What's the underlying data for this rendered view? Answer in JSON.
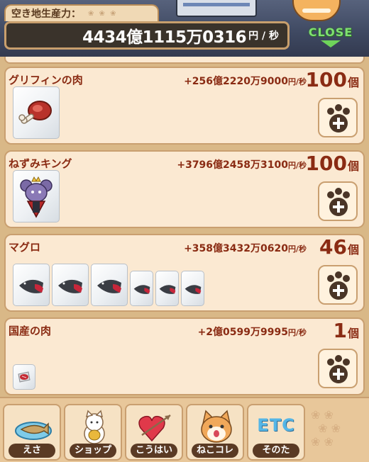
{
  "header": {
    "title": "空き地生産力：",
    "total_rate": "4434億1115万0316",
    "rate_unit": "円 / 秒",
    "close_label": "CLOSE"
  },
  "items": [
    {
      "name": "グリフィンの肉",
      "rate": "+256億2220万9000",
      "rate_unit": "円/秒",
      "count": "100",
      "count_unit": "個",
      "icon": "meat-leg-icon",
      "packs_shown": 1
    },
    {
      "name": "ねずみキング",
      "rate": "+3796億2458万3100",
      "rate_unit": "円/秒",
      "count": "100",
      "count_unit": "個",
      "icon": "rat-king-icon",
      "packs_shown": 1
    },
    {
      "name": "マグロ",
      "rate": "+358億3432万0620",
      "rate_unit": "円/秒",
      "count": "46",
      "count_unit": "個",
      "icon": "tuna-icon",
      "packs_shown": 6
    },
    {
      "name": "国産の肉",
      "rate": "+2億0599万9995",
      "rate_unit": "円/秒",
      "count": "1",
      "count_unit": "個",
      "icon": "steak-icon",
      "packs_shown": 1
    }
  ],
  "tabs": [
    {
      "label": "えさ",
      "icon": "fish-plate-icon"
    },
    {
      "label": "ショップ",
      "icon": "lucky-cat-icon"
    },
    {
      "label": "こうはい",
      "icon": "heart-arrow-icon"
    },
    {
      "label": "ねこコレ",
      "icon": "cat-face-icon"
    },
    {
      "label": "そのた",
      "icon": "etc-icon",
      "icon_text": "ETC"
    }
  ],
  "colors": {
    "accent_text": "#8a2b13",
    "card_bg": "#fbe9d2",
    "rate_bar_bg": "#3a332b",
    "close_green": "#7fe071",
    "etc_blue": "#55b6e6"
  }
}
